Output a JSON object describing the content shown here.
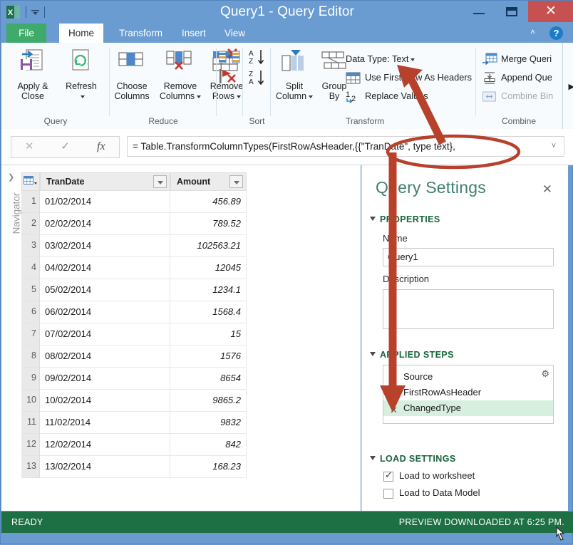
{
  "window": {
    "title": "Query1 - Query Editor",
    "quick_access": [
      "excel-logo",
      "customize-quick-access"
    ],
    "buttons": {
      "minimize": "–",
      "maximize": "❐",
      "close": "✕"
    }
  },
  "ribbon": {
    "tabs": [
      {
        "label": "File",
        "active": false,
        "style": "file"
      },
      {
        "label": "Home",
        "active": true
      },
      {
        "label": "Transform",
        "active": false
      },
      {
        "label": "Insert",
        "active": false
      },
      {
        "label": "View",
        "active": false
      }
    ],
    "help_label": "?",
    "collapse_label": "˄",
    "groups": [
      {
        "name": "Query",
        "label": "Query",
        "big_buttons": [
          {
            "label_line1": "Apply &",
            "label_line2": "Close",
            "icon": "apply-close-icon",
            "has_caret": false
          },
          {
            "label_line1": "Refresh",
            "label_line2": "",
            "icon": "refresh-icon",
            "has_caret": true
          }
        ]
      },
      {
        "name": "Reduce",
        "label": "Reduce",
        "big_buttons": [
          {
            "label_line1": "Choose",
            "label_line2": "Columns",
            "icon": "choose-columns-icon",
            "has_caret": false
          },
          {
            "label_line1": "Remove",
            "label_line2": "Columns",
            "icon": "remove-columns-icon",
            "has_caret": true
          },
          {
            "label_line1": "Remove",
            "label_line2": "Rows",
            "icon": "remove-rows-icon",
            "has_caret": true
          }
        ],
        "extra_icons": [
          "keep-duplicates-icon",
          "remove-errors-icon"
        ]
      },
      {
        "name": "Sort",
        "label": "Sort",
        "icons": [
          "sort-ascending-icon",
          "sort-descending-icon"
        ]
      },
      {
        "name": "Transform",
        "label": "Transform",
        "big_buttons": [
          {
            "label_line1": "Split",
            "label_line2": "Column",
            "icon": "split-column-icon",
            "has_caret": true
          },
          {
            "label_line1": "Group",
            "label_line2": "By",
            "icon": "group-by-icon",
            "has_caret": false
          }
        ],
        "small_buttons": [
          {
            "label": "Data Type: Text",
            "icon": "data-type-icon",
            "has_caret": true,
            "disabled": false
          },
          {
            "label": "Use First Row As Headers",
            "icon": "first-row-headers-icon",
            "has_caret": false,
            "disabled": false
          },
          {
            "label": "Replace Values",
            "icon": "replace-values-icon",
            "has_caret": false,
            "disabled": false
          }
        ]
      },
      {
        "name": "Combine",
        "label": "Combine",
        "small_buttons": [
          {
            "label": "Merge Queri",
            "icon": "merge-queries-icon",
            "disabled": false
          },
          {
            "label": "Append Que",
            "icon": "append-queries-icon",
            "disabled": false
          },
          {
            "label": "Combine Bin",
            "icon": "combine-binaries-icon",
            "disabled": true
          }
        ],
        "overflow_label": "▶"
      }
    ]
  },
  "formula_bar": {
    "cancel_label": "✕",
    "accept_label": "✓",
    "fx_label": "fx",
    "value": "= Table.TransformColumnTypes(FirstRowAsHeader,{{\"TranDate\", type text},",
    "expand_label": "˅"
  },
  "navigator": {
    "label": "Navigator",
    "chevron": "❯"
  },
  "grid": {
    "columns": [
      "TranDate",
      "Amount"
    ],
    "rows": [
      {
        "n": "1",
        "TranDate": "01/02/2014",
        "Amount": "456.89"
      },
      {
        "n": "2",
        "TranDate": "02/02/2014",
        "Amount": "789.52"
      },
      {
        "n": "3",
        "TranDate": "03/02/2014",
        "Amount": "102563.21"
      },
      {
        "n": "4",
        "TranDate": "04/02/2014",
        "Amount": "12045"
      },
      {
        "n": "5",
        "TranDate": "05/02/2014",
        "Amount": "1234.1"
      },
      {
        "n": "6",
        "TranDate": "06/02/2014",
        "Amount": "1568.4"
      },
      {
        "n": "7",
        "TranDate": "07/02/2014",
        "Amount": "15"
      },
      {
        "n": "8",
        "TranDate": "08/02/2014",
        "Amount": "1576"
      },
      {
        "n": "9",
        "TranDate": "09/02/2014",
        "Amount": "8654"
      },
      {
        "n": "10",
        "TranDate": "10/02/2014",
        "Amount": "9865.2"
      },
      {
        "n": "11",
        "TranDate": "11/02/2014",
        "Amount": "9832"
      },
      {
        "n": "12",
        "TranDate": "12/02/2014",
        "Amount": "842"
      },
      {
        "n": "13",
        "TranDate": "13/02/2014",
        "Amount": "168.23"
      }
    ]
  },
  "query_settings": {
    "title": "Query Settings",
    "close_label": "✕",
    "properties": {
      "heading": "PROPERTIES",
      "name_label": "Name",
      "name_value": "Query1",
      "description_label": "Description",
      "description_value": ""
    },
    "applied_steps": {
      "heading": "APPLIED STEPS",
      "gear_label": "⚙",
      "steps": [
        {
          "label": "Source",
          "selected": false,
          "deletable": false
        },
        {
          "label": "FirstRowAsHeader",
          "selected": false,
          "deletable": false
        },
        {
          "label": "ChangedType",
          "selected": true,
          "deletable": true,
          "delete_label": "✕"
        }
      ]
    },
    "load_settings": {
      "heading": "LOAD SETTINGS",
      "options": [
        {
          "label": "Load to worksheet",
          "checked": true
        },
        {
          "label": "Load to Data Model",
          "checked": false
        }
      ]
    }
  },
  "status_bar": {
    "left": "READY",
    "right": "PREVIEW DOWNLOADED AT 6:25 PM."
  },
  "annotations": {
    "color": "#b8412c",
    "ellipse_target": "formula-trandate-type-text",
    "arrow_up_target": "data-type-text-button",
    "arrow_down_target": "applied-step-changedtype"
  },
  "colors": {
    "titlebar": "#6a9bd1",
    "file_tab": "#3faa6a",
    "status_bar": "#1d7044",
    "selected_step": "#d7efdf",
    "heading_green": "#17643a",
    "pane_title": "#3f7f6f",
    "close_button": "#c75050",
    "annotation_red": "#b8412c"
  }
}
